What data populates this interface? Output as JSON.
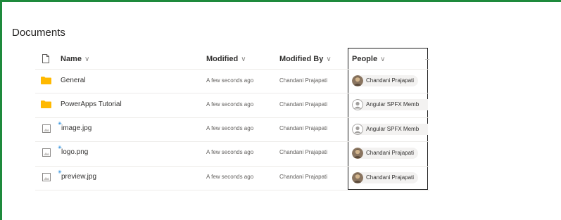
{
  "library": {
    "title": "Documents"
  },
  "columns": {
    "name": "Name",
    "modified": "Modified",
    "modified_by": "Modified By",
    "people": "People",
    "chevron": "∨"
  },
  "rows": [
    {
      "type": "folder",
      "name": "General",
      "modified": "A few seconds ago",
      "modified_by": "Chandani Prajapati",
      "person": "Chandani Prajapati",
      "avatar": "photo"
    },
    {
      "type": "folder",
      "name": "PowerApps Tutorial",
      "modified": "A few seconds ago",
      "modified_by": "Chandani Prajapati",
      "person": "Angular SPFX Memb",
      "avatar": "generic"
    },
    {
      "type": "image",
      "name": "image.jpg",
      "modified": "A few seconds ago",
      "modified_by": "Chandani Prajapati",
      "person": "Angular SPFX Memb",
      "avatar": "generic"
    },
    {
      "type": "image",
      "name": "logo.png",
      "modified": "A few seconds ago",
      "modified_by": "Chandani Prajapati",
      "person": "Chandani Prajapati",
      "avatar": "photo"
    },
    {
      "type": "image",
      "name": "preview.jpg",
      "modified": "A few seconds ago",
      "modified_by": "Chandani Prajapati",
      "person": "Chandani Prajapati",
      "avatar": "photo"
    }
  ],
  "colors": {
    "accent_border": "#1e8a3c",
    "folder": "#ffb900",
    "new_badge": "#0078d4"
  },
  "icons": {
    "header_file": "file-type-icon",
    "folder": "folder-icon",
    "image": "image-file-icon",
    "new": "new-item-badge-icon"
  }
}
